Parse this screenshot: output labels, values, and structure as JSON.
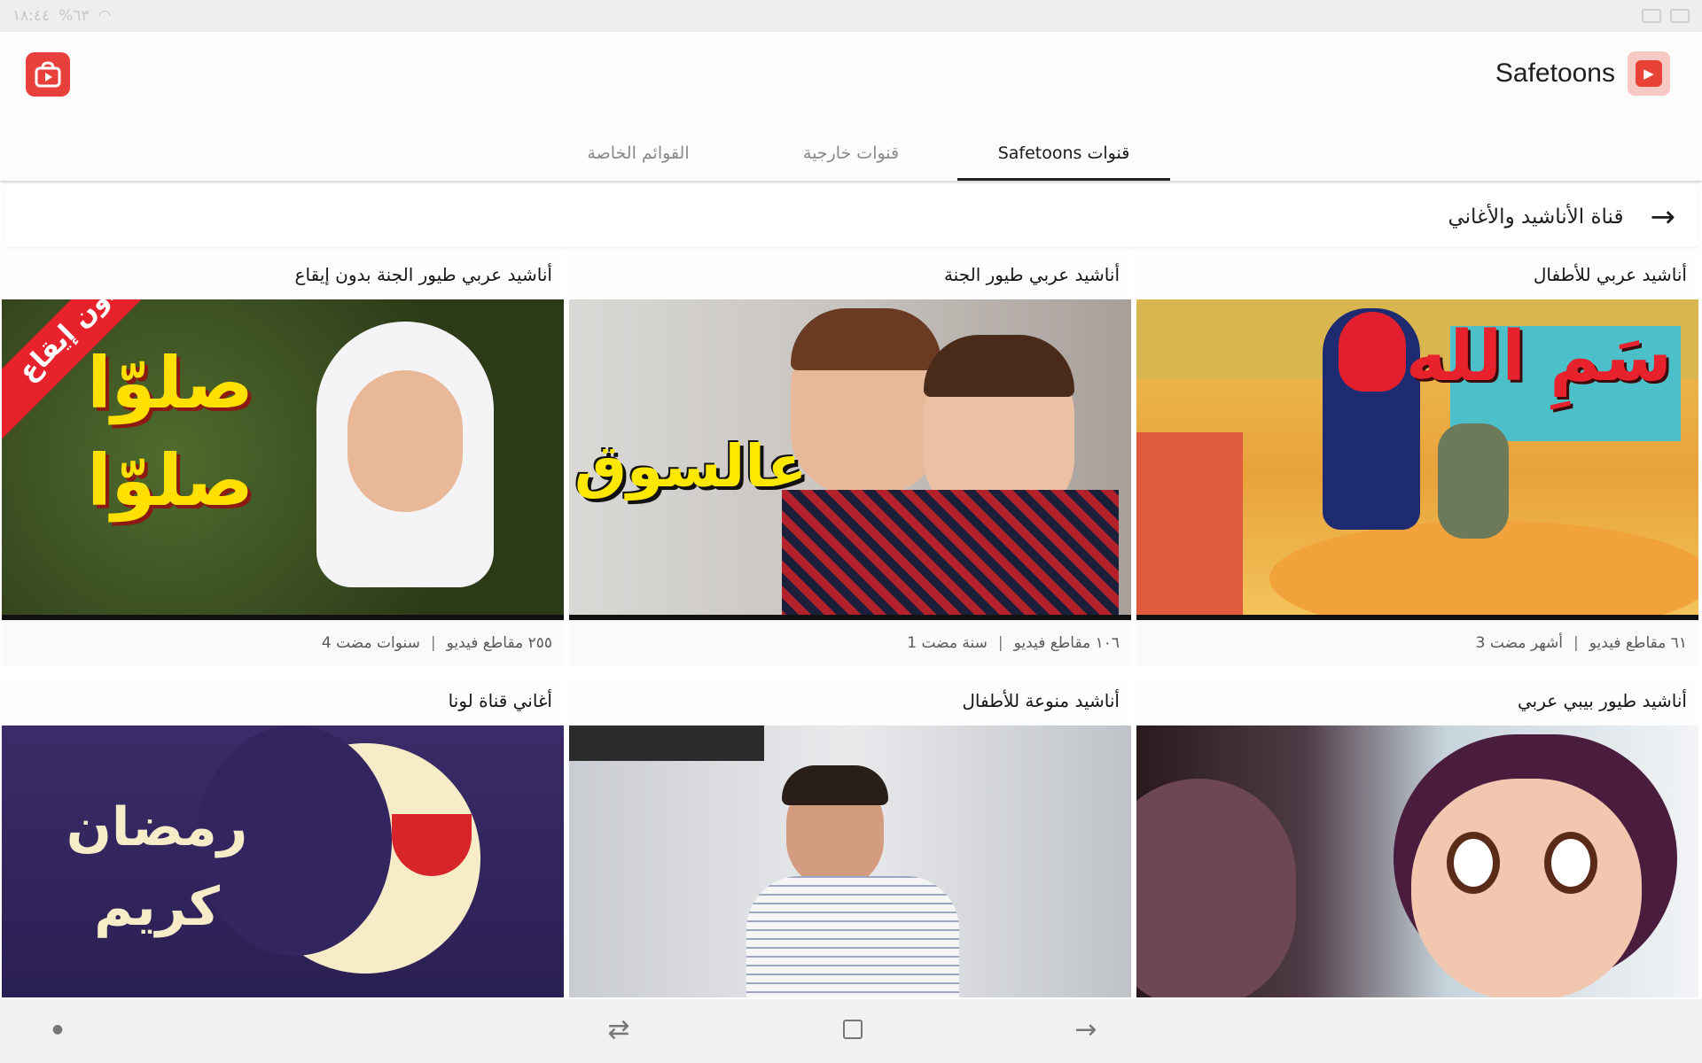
{
  "status_bar": {
    "time": "١٨:٤٤",
    "battery": "%٦٣"
  },
  "header": {
    "app_title": "Safetoons",
    "logo_icon": "play-bag-icon",
    "brand_logo_icon": "kids-logo-icon",
    "accent": "#e8403b"
  },
  "tabs": [
    {
      "label": "قنوات Safetoons",
      "active": true
    },
    {
      "label": "قنوات خارجية",
      "active": false
    },
    {
      "label": "القوائم الخاصة",
      "active": false
    }
  ],
  "section": {
    "title": "قناة الأناشيد والأغاني",
    "icon": "arrow-right-icon"
  },
  "cards": [
    {
      "title": "أناشيد عربي للأطفال",
      "videos": "٦١ مقاطع فيديو",
      "age": "3 أشهر مضت",
      "thumb_text": "سَمِ الله"
    },
    {
      "title": "أناشيد عربي طيور الجنة",
      "videos": "١٠٦ مقاطع فيديو",
      "age": "1 سنة مضت",
      "thumb_text": "عالسوق"
    },
    {
      "title": "أناشيد عربي طيور الجنة بدون إيقاع",
      "videos": "٢٥٥ مقاطع فيديو",
      "age": "4 سنوات مضت",
      "thumb_text": "صلوّا صلوّا",
      "ribbon": "بدون إيقاع"
    },
    {
      "title": "أناشيد طيور بيبي عربي",
      "videos": "",
      "age": ""
    },
    {
      "title": "أناشيد منوعة للأطفال",
      "videos": "",
      "age": ""
    },
    {
      "title": "أغاني قناة لونا",
      "videos": "",
      "age": "",
      "thumb_text": "رمضان كريم"
    }
  ],
  "nav_bar": {
    "items": [
      "back-icon",
      "home-icon",
      "recent-apps-icon",
      "dot-icon"
    ]
  }
}
